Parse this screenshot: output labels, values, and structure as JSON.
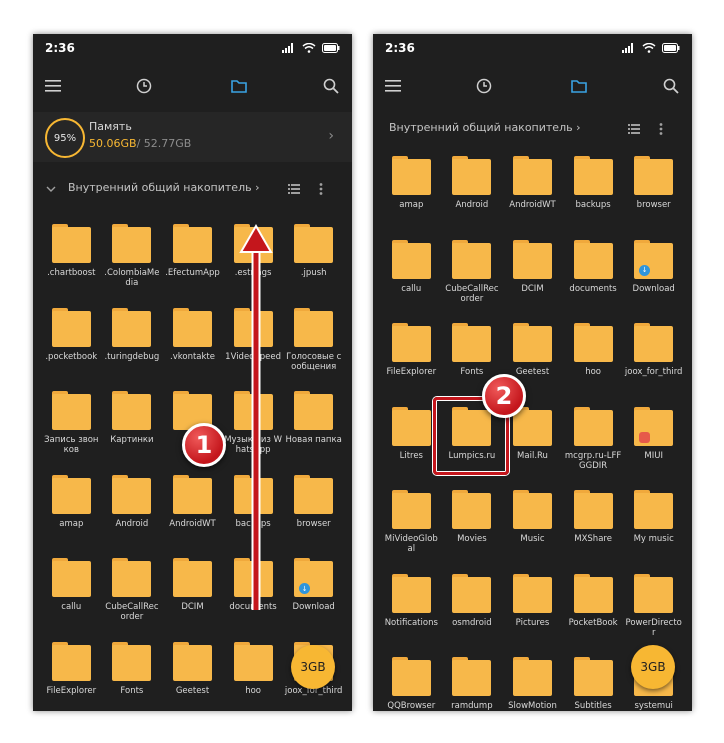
{
  "colors": {
    "accent": "#f7b733",
    "folder": "#f7b84a",
    "background": "#1f1f1f",
    "annotation": "#c4161c"
  },
  "status_bar": {
    "time": "2:36",
    "icons": [
      "signal-icon",
      "wifi-icon",
      "battery-icon"
    ]
  },
  "toolbar": {
    "icons": [
      "menu-icon",
      "clock-icon",
      "folder-icon",
      "search-icon"
    ],
    "active": "folder-icon"
  },
  "left_screen": {
    "storage": {
      "percent": "95%",
      "title": "Память",
      "used": "50.06GB",
      "total": "/ 52.77GB"
    },
    "breadcrumb": "Внутренний общий накопитель",
    "folders": [
      {
        "name": ".chartboost"
      },
      {
        "name": ".ColombiaMedia"
      },
      {
        "name": ".EfectumApp"
      },
      {
        "name": ".estrings"
      },
      {
        "name": ".jpush"
      },
      {
        "name": ".pocketbook"
      },
      {
        "name": ".turingdebug"
      },
      {
        "name": ".vkontakte"
      },
      {
        "name": "1VideoSpeed"
      },
      {
        "name": "Голосовые сообщения"
      },
      {
        "name": "Запись звонков"
      },
      {
        "name": "Картинки"
      },
      {
        "name": ""
      },
      {
        "name": "Музыка из WhatsApp"
      },
      {
        "name": "Новая папка"
      },
      {
        "name": "amap"
      },
      {
        "name": "Android"
      },
      {
        "name": "AndroidWT"
      },
      {
        "name": "backups"
      },
      {
        "name": "browser"
      },
      {
        "name": "callu"
      },
      {
        "name": "CubeCallRecorder"
      },
      {
        "name": "DCIM"
      },
      {
        "name": "documents"
      },
      {
        "name": "Download",
        "badge": "download"
      },
      {
        "name": "FileExplorer"
      },
      {
        "name": "Fonts"
      },
      {
        "name": "Geetest"
      },
      {
        "name": "hoo"
      },
      {
        "name": "joox_for_third"
      }
    ],
    "fab_label": "3GB",
    "step_number": "1"
  },
  "right_screen": {
    "breadcrumb": "Внутренний общий накопитель",
    "folders": [
      {
        "name": "amap"
      },
      {
        "name": "Android"
      },
      {
        "name": "AndroidWT"
      },
      {
        "name": "backups"
      },
      {
        "name": "browser"
      },
      {
        "name": "callu"
      },
      {
        "name": "CubeCallRecorder"
      },
      {
        "name": "DCIM"
      },
      {
        "name": "documents"
      },
      {
        "name": "Download",
        "badge": "download"
      },
      {
        "name": "FileExplorer"
      },
      {
        "name": "Fonts"
      },
      {
        "name": "Geetest"
      },
      {
        "name": "hoo"
      },
      {
        "name": "joox_for_third"
      },
      {
        "name": "Litres"
      },
      {
        "name": "Lumpics.ru"
      },
      {
        "name": "Mail.Ru"
      },
      {
        "name": "mcgrp.ru-LFFGGDIR"
      },
      {
        "name": "MIUI",
        "badge": "miui"
      },
      {
        "name": "MiVideoGlobal"
      },
      {
        "name": "Movies"
      },
      {
        "name": "Music"
      },
      {
        "name": "MXShare"
      },
      {
        "name": "My music"
      },
      {
        "name": "Notifications"
      },
      {
        "name": "osmdroid"
      },
      {
        "name": "Pictures"
      },
      {
        "name": "PocketBook"
      },
      {
        "name": "PowerDirector"
      },
      {
        "name": "QQBrowser"
      },
      {
        "name": "ramdump"
      },
      {
        "name": "SlowMotion"
      },
      {
        "name": "Subtitles"
      },
      {
        "name": "systemui"
      }
    ],
    "fab_label": "3GB",
    "step_number": "2"
  }
}
